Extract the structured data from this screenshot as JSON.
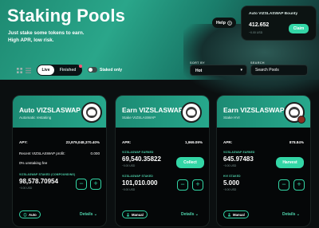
{
  "header": {
    "title": "Staking Pools",
    "subtitle_line1": "Just stake some tokens to earn.",
    "subtitle_line2": "High APR, low risk.",
    "help_label": "Help"
  },
  "bounty": {
    "title": "Auto VIZSLASWAP Bounty",
    "value": "412.652",
    "usd": "~0.00 USD",
    "claim_label": "Claim"
  },
  "toolbar": {
    "live_label": "Live",
    "finished_label": "Finished",
    "staked_only_label": "Staked only",
    "sort_label": "SORT BY",
    "sort_value": "Hot",
    "search_label": "SEARCH",
    "search_placeholder": "Search Pools"
  },
  "cards": [
    {
      "title": "Auto VIZSLASWAP",
      "subtitle": "Automatic restaking",
      "apy_label": "APY:",
      "apy_value": "23,979,048,370.40%",
      "profit_label": "Recent VIZSLASWAP profit:",
      "profit_value": "0.000",
      "fee_label": "0% unstaking fee",
      "staked_label": "VIZSLASWAP STAKED (COMPOUNDING)",
      "staked_value": "98,578.70954",
      "staked_usd": "~0.00 USD",
      "minus": "−",
      "plus": "+",
      "tag_label": "Auto",
      "details_label": "Details"
    },
    {
      "title": "Earn VIZSLASWAP",
      "subtitle": "Stake VIZSLASWAP",
      "apr_label": "APR:",
      "apr_value": "1,969.09%",
      "earned_label": "VIZSLASWAP EARNED",
      "earned_value": "69,540.35822",
      "earned_usd": "~0.00 USD",
      "action_label": "Collect",
      "staked_label": "VIZSLASWAP STAKED",
      "staked_value": "101,010.000",
      "staked_usd": "~0.00 USD",
      "minus": "−",
      "plus": "+",
      "tag_label": "Manual",
      "details_label": "Details"
    },
    {
      "title": "Earn VIZSLASWAP",
      "subtitle": "Stake HVI",
      "apr_label": "APR:",
      "apr_value": "878.84%",
      "earned_label": "VIZSLASWAP EARNED",
      "earned_value": "645.97483",
      "earned_usd": "~0.00 USD",
      "action_label": "Harvest",
      "staked_label": "HVI STAKED",
      "staked_value": "5.000",
      "staked_usd": "~0.00 USD",
      "minus": "−",
      "plus": "+",
      "tag_label": "Manual",
      "details_label": "Details"
    }
  ],
  "colors": {
    "accent": "#33d6a6",
    "card_header": "#1f8f78",
    "background": "#0b0f10"
  },
  "icons": [
    "help-icon",
    "card-view-icon",
    "list-view-icon",
    "chevron-down-icon",
    "sync-icon",
    "manual-icon",
    "vizsla-logo-icon"
  ]
}
